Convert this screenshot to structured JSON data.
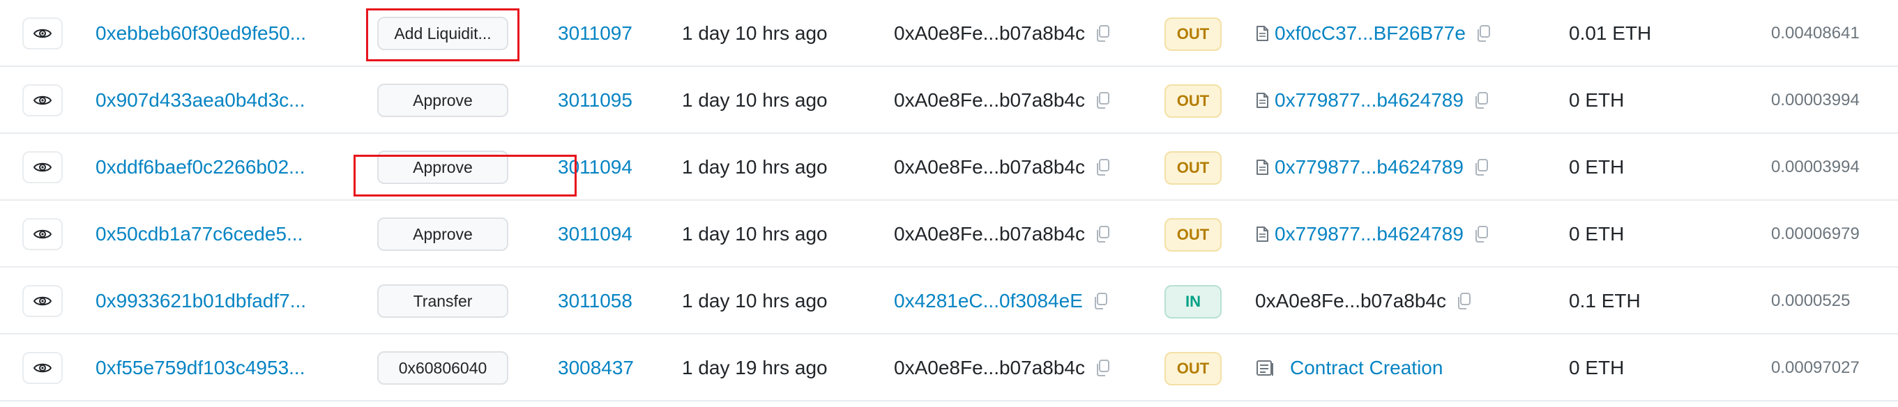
{
  "transactions": [
    {
      "hash": "0xebbeb60f30ed9fe50...",
      "method": "Add Liquidit...",
      "block": "3011097",
      "age": "1 day 10 hrs ago",
      "from": "0xA0e8Fe...b07a8b4c",
      "from_is_link": false,
      "direction": "OUT",
      "to": "0xf0cC37...BF26B77e",
      "to_type": "contract",
      "value": "0.01 ETH",
      "fee": "0.00408641"
    },
    {
      "hash": "0x907d433aea0b4d3c...",
      "method": "Approve",
      "block": "3011095",
      "age": "1 day 10 hrs ago",
      "from": "0xA0e8Fe...b07a8b4c",
      "from_is_link": false,
      "direction": "OUT",
      "to": "0x779877...b4624789",
      "to_type": "contract",
      "value": "0 ETH",
      "fee": "0.00003994"
    },
    {
      "hash": "0xddf6baef0c2266b02...",
      "method": "Approve",
      "block": "3011094",
      "age": "1 day 10 hrs ago",
      "from": "0xA0e8Fe...b07a8b4c",
      "from_is_link": false,
      "direction": "OUT",
      "to": "0x779877...b4624789",
      "to_type": "contract",
      "value": "0 ETH",
      "fee": "0.00003994"
    },
    {
      "hash": "0x50cdb1a77c6cede5...",
      "method": "Approve",
      "block": "3011094",
      "age": "1 day 10 hrs ago",
      "from": "0xA0e8Fe...b07a8b4c",
      "from_is_link": false,
      "direction": "OUT",
      "to": "0x779877...b4624789",
      "to_type": "contract",
      "value": "0 ETH",
      "fee": "0.00006979"
    },
    {
      "hash": "0x9933621b01dbfadf7...",
      "method": "Transfer",
      "block": "3011058",
      "age": "1 day 10 hrs ago",
      "from": "0x4281eC...0f3084eE",
      "from_is_link": true,
      "direction": "IN",
      "to": "0xA0e8Fe...b07a8b4c",
      "to_type": "plain",
      "value": "0.1 ETH",
      "fee": "0.0000525"
    },
    {
      "hash": "0xf55e759df103c4953...",
      "method": "0x60806040",
      "block": "3008437",
      "age": "1 day 19 hrs ago",
      "from": "0xA0e8Fe...b07a8b4c",
      "from_is_link": false,
      "direction": "OUT",
      "to": "Contract Creation",
      "to_type": "creation",
      "value": "0 ETH",
      "fee": "0.00097027"
    }
  ],
  "icons": {
    "view": "eye-icon",
    "copy": "copy-icon",
    "contract": "document-icon",
    "creation": "contract-creation-icon"
  },
  "colors": {
    "link": "#0784c3",
    "out_badge": "#b47d00",
    "in_badge": "#00a186",
    "highlight": "#e8141c"
  }
}
